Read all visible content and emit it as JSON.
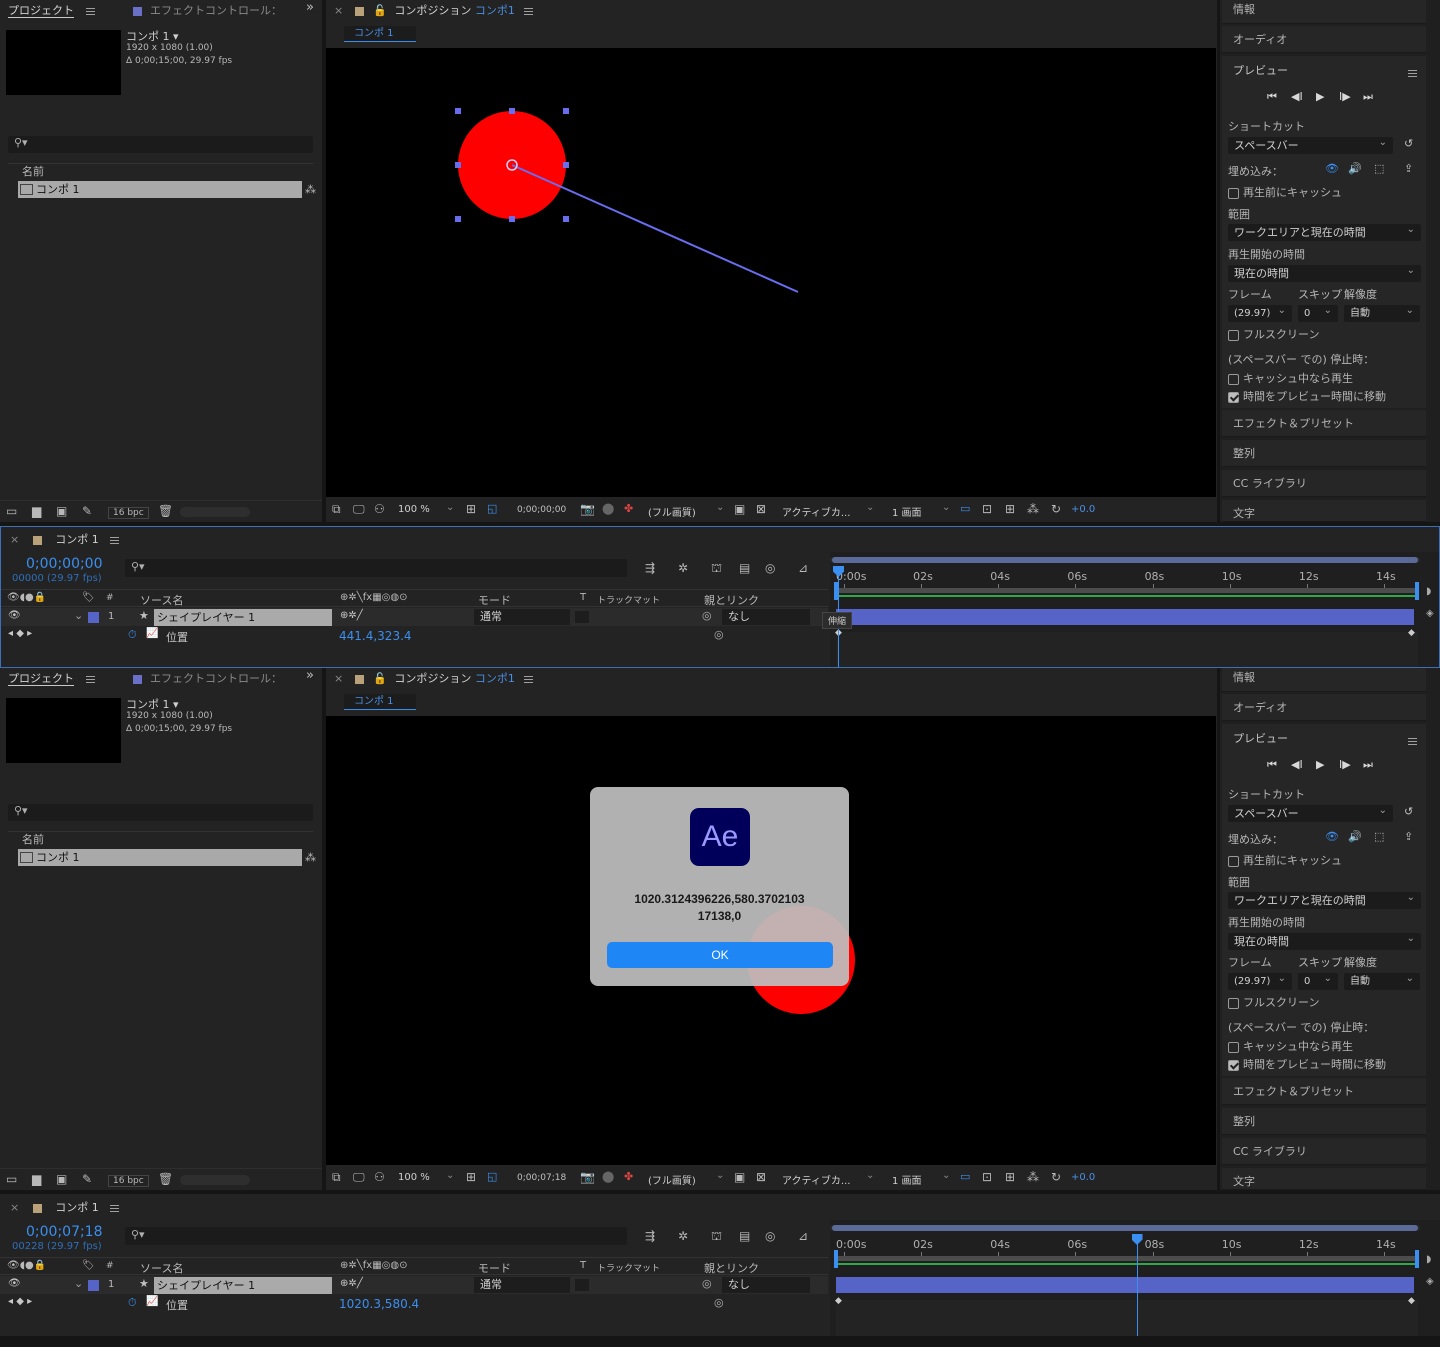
{
  "app": {
    "panel_project": "プロジェクト",
    "panel_effect_controls": "エフェクトコントロール：",
    "panel_composition": "コンポジション",
    "comp_name": "コンポ 1",
    "comp_tab": "コンポ 1",
    "comp_link": "コンポ1"
  },
  "project": {
    "item_name": "コンポ 1 ▾",
    "resolution": "1920 x 1080 (1.00)",
    "duration": "Δ 0;00;15;00, 29.97 fps",
    "col_name": "名前",
    "list_item": "コンポ 1",
    "bpc": "16 bpc"
  },
  "viewer_bottom": {
    "zoom": "100 %",
    "quality": "(フル画質)",
    "camera": "アクティブカ...",
    "view": "1 画面",
    "exposure": "+0.0"
  },
  "right_panel": {
    "info": "情報",
    "audio": "オーディオ",
    "preview": "プレビュー",
    "shortcut_label": "ショートカット",
    "shortcut_value": "スペースバー",
    "embed_label": "埋め込み：",
    "cache_before": "再生前にキャッシュ",
    "range_label": "範囲",
    "range_value": "ワークエリアと現在の時間",
    "play_from_label": "再生開始の時間",
    "play_from_value": "現在の時間",
    "frame_label": "フレーム",
    "skip_label": "スキップ",
    "res_label": "解像度",
    "frame_value": "(29.97)",
    "skip_value": "0",
    "res_value": "自動",
    "fullscreen": "フルスクリーン",
    "stop_label": "(スペースバー での) 停止時：",
    "if_caching": "キャッシュ中なら再生",
    "move_time": "時間をプレビュー時間に移動",
    "effects_presets": "エフェクト＆プリセット",
    "align": "整列",
    "cc_libraries": "CC ライブラリ",
    "text": "文字"
  },
  "timeline": {
    "comp_name": "コンポ 1",
    "col_source": "ソース名",
    "col_mode": "モード",
    "col_trkmat": "トラックマット",
    "col_parent": "親とリンク",
    "layer_num": "1",
    "layer_name": "シェイプレイヤー 1",
    "layer_mode": "通常",
    "layer_parent": "なし",
    "prop_name": "位置",
    "stretch_tooltip": "伸縮",
    "ticks": [
      "0:00s",
      "02s",
      "04s",
      "06s",
      "08s",
      "10s",
      "12s",
      "14s"
    ]
  },
  "state_a": {
    "viewer_time": "0;00;00;00",
    "timecode": "0;00;00;00",
    "frame_info": "00000 (29.97 fps)",
    "position_value": "441.4,323.4",
    "playhead_fraction": 0.0
  },
  "state_b": {
    "viewer_time": "0;00;07;18",
    "timecode": "0;00;07;18",
    "frame_info": "00228 (29.97 fps)",
    "position_value": "1020.3,580.4",
    "playhead_fraction": 0.5112
  },
  "alert": {
    "app_icon_text": "Ae",
    "message_line1": "1020.3124396226,580.3702103",
    "message_line2": "17138,0",
    "ok_label": "OK"
  },
  "colors": {
    "accent_blue": "#3b8ff0",
    "layer_bar": "#5664c8",
    "shape_red": "#ff0000",
    "ae_icon_bg": "#00005b",
    "ae_icon_fg": "#9999ff"
  }
}
